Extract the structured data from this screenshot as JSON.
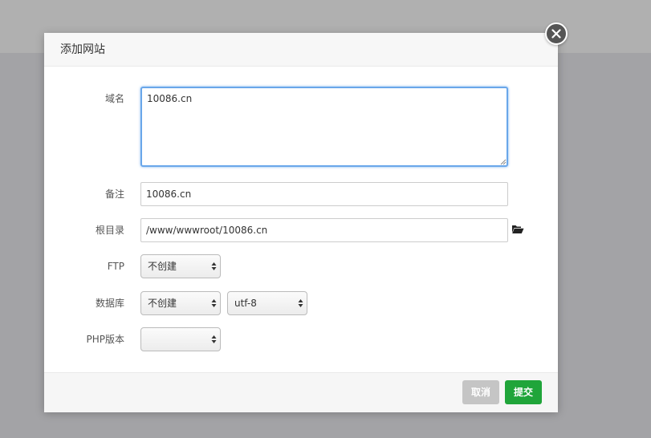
{
  "dialog": {
    "title": "添加网站",
    "close_icon": "close-icon"
  },
  "form": {
    "domain": {
      "label": "域名",
      "value": "10086.cn"
    },
    "remark": {
      "label": "备注",
      "value": "10086.cn"
    },
    "root_dir": {
      "label": "根目录",
      "value": "/www/wwwroot/10086.cn",
      "icon": "folder-open-icon"
    },
    "ftp": {
      "label": "FTP",
      "selected": "不创建"
    },
    "database": {
      "label": "数据库",
      "selected": "不创建",
      "charset_selected": "utf-8"
    },
    "php_version": {
      "label": "PHP版本",
      "selected": ""
    }
  },
  "footer": {
    "cancel_label": "取消",
    "submit_label": "提交"
  },
  "colors": {
    "submit": "#20a53a",
    "cancel": "#c5c5c5",
    "focus": "#6aa7ea"
  }
}
